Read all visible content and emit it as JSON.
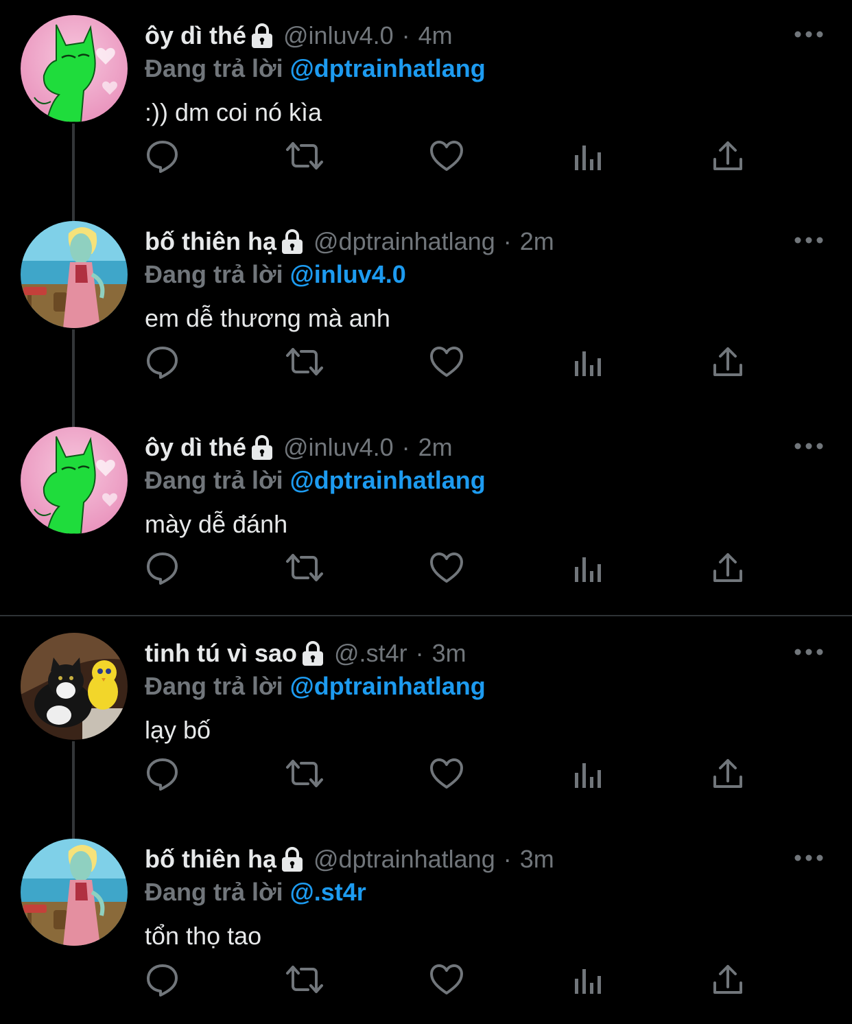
{
  "colors": {
    "background": "#000000",
    "primary_text": "#e7e9ea",
    "secondary_text": "#71767b",
    "link": "#1d9bf0",
    "thread_line": "#333639"
  },
  "tweets": [
    {
      "display_name": "ôy dì thé",
      "handle": "@inluv4.0",
      "separator": "·",
      "time": "4m",
      "reply_prefix": "Đang trả lời",
      "reply_to": "@dptrainhatlang",
      "text": ":)) dm coi nó kìa",
      "avatar": "green-cat-avatar",
      "protected_icon": "lock-icon"
    },
    {
      "display_name": "bố thiên hạ",
      "handle": "@dptrainhatlang",
      "separator": "·",
      "time": "2m",
      "reply_prefix": "Đang trả lời",
      "reply_to": "@inluv4.0",
      "text": "em dễ thương mà anh",
      "avatar": "squidward-avatar",
      "protected_icon": "lock-icon"
    },
    {
      "display_name": "ôy dì thé",
      "handle": "@inluv4.0",
      "separator": "·",
      "time": "2m",
      "reply_prefix": "Đang trả lời",
      "reply_to": "@dptrainhatlang",
      "text": "mày dễ đánh",
      "avatar": "green-cat-avatar",
      "protected_icon": "lock-icon"
    },
    {
      "display_name": "tinh tú vì sao",
      "handle": "@.st4r",
      "separator": "·",
      "time": "3m",
      "reply_prefix": "Đang trả lời",
      "reply_to": "@dptrainhatlang",
      "text": "lạy bố",
      "avatar": "cat-tweety-avatar",
      "protected_icon": "lock-icon"
    },
    {
      "display_name": "bố thiên hạ",
      "handle": "@dptrainhatlang",
      "separator": "·",
      "time": "3m",
      "reply_prefix": "Đang trả lời",
      "reply_to": "@.st4r",
      "text": "tổn thọ tao",
      "avatar": "squidward-avatar",
      "protected_icon": "lock-icon"
    }
  ],
  "action_icons": [
    "reply-icon",
    "retweet-icon",
    "like-icon",
    "analytics-icon",
    "share-icon"
  ],
  "menu_icon": "more-icon"
}
